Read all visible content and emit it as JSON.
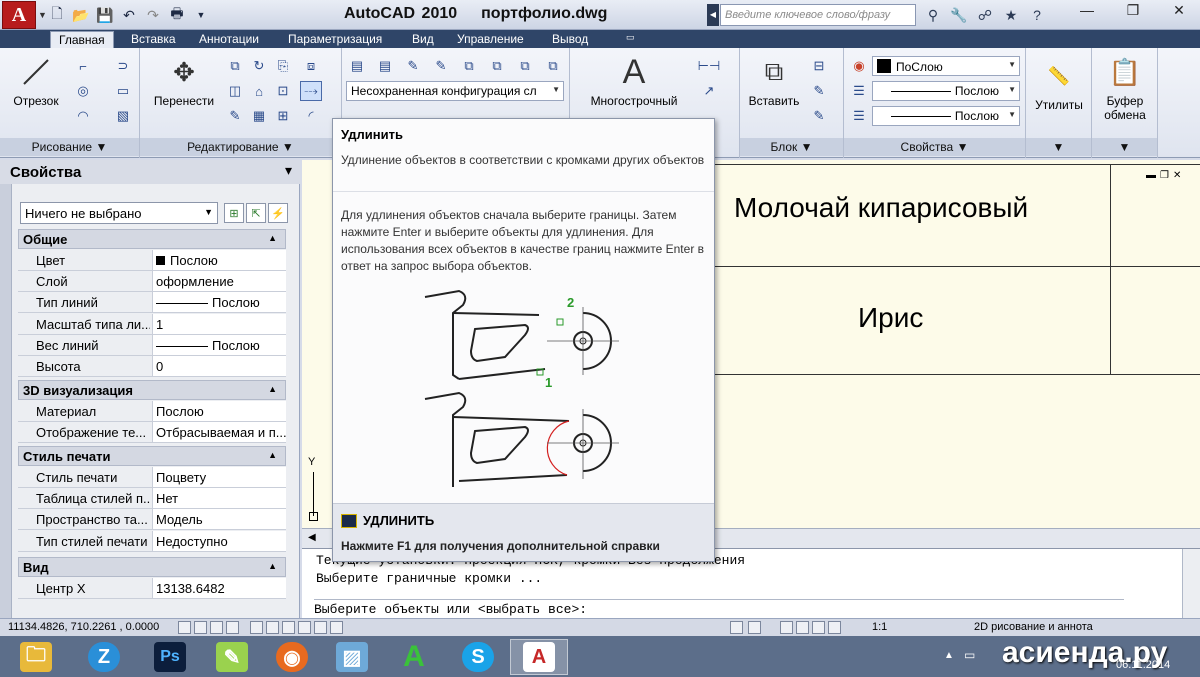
{
  "title": {
    "app": "AutoCAD 2010",
    "file": "портфолио.dwg"
  },
  "search": {
    "placeholder": "Введите ключевое слово/фразу"
  },
  "tabs": [
    "Главная",
    "Вставка",
    "Аннотации",
    "Параметризация",
    "Вид",
    "Управление",
    "Вывод"
  ],
  "ribbon": {
    "draw": {
      "line_label": "Отрезок",
      "panel_label": "Рисование"
    },
    "modify": {
      "move_label": "Перенести",
      "panel_label": "Редактирование"
    },
    "layers": {
      "state_value": "Несохраненная конфигурация сл"
    },
    "annotation": {
      "mtext_label": "Многострочный"
    },
    "block": {
      "insert_label": "Вставить",
      "panel_label": "Блок"
    },
    "properties": {
      "color_value": "ПоСлою",
      "linetype_value": "Послою",
      "lineweight_value": "Послою",
      "panel_label": "Свойства"
    },
    "utilities": {
      "label": "Утилиты"
    },
    "clipboard": {
      "label_line1": "Буфер",
      "label_line2": "обмена"
    }
  },
  "props": {
    "title": "Свойства",
    "selection": "Ничего не выбрано",
    "sections": {
      "general": "Общие",
      "viz3d": "3D визуализация",
      "plot": "Стиль печати",
      "view": "Вид"
    },
    "general_rows": [
      {
        "k": "Цвет",
        "v": "Послою"
      },
      {
        "k": "Слой",
        "v": "оформление"
      },
      {
        "k": "Тип линий",
        "v": "Послою"
      },
      {
        "k": "Масштаб типа ли...",
        "v": "1"
      },
      {
        "k": "Вес линий",
        "v": "Послою"
      },
      {
        "k": "Высота",
        "v": "0"
      }
    ],
    "viz_rows": [
      {
        "k": "Материал",
        "v": "Послою"
      },
      {
        "k": "Отображение те...",
        "v": "Отбрасываемая и п..."
      }
    ],
    "plot_rows": [
      {
        "k": "Стиль печати",
        "v": "Поцвету"
      },
      {
        "k": "Таблица стилей п...",
        "v": "Нет"
      },
      {
        "k": "Пространство та...",
        "v": "Модель"
      },
      {
        "k": "Тип стилей печати",
        "v": "Недоступно"
      }
    ],
    "view_rows": [
      {
        "k": "Центр X",
        "v": "13138.6482"
      }
    ]
  },
  "drawing": {
    "cell1": "Молочай кипарисовый",
    "cell2": "Ирис",
    "axis_y": "Y"
  },
  "tooltip": {
    "title": "Удлинить",
    "description": "Удлинение объектов в соответствии с кромками других объектов",
    "body": "Для удлинения объектов сначала выберите границы. Затем нажмите Enter и выберите объекты для удлинения. Для использования всех объектов в качестве границ нажмите Enter в ответ на запрос выбора объектов.",
    "label1": "1",
    "label2": "2",
    "command": "УДЛИНИТЬ",
    "help": "Нажмите F1 для получения дополнительной справки"
  },
  "command_line": {
    "line1": "Текущие установки: проекция=ПСК, кромки=Без продолжения",
    "line2": "Выберите граничные кромки ...",
    "prompt": "Выберите объекты или <выбрать все>:"
  },
  "status": {
    "coords": "11134.4826, 710.2261 , 0.0000",
    "scale": "1:1",
    "workspace": "2D рисование и аннота"
  },
  "taskbar": {
    "date": "06.11.2014",
    "watermark": "асиенда.ру"
  },
  "colors": {
    "title_tab_bg": "#2f4568",
    "canvas_bg": "#fdfbe9",
    "autocad_red": "#b71c1c"
  }
}
